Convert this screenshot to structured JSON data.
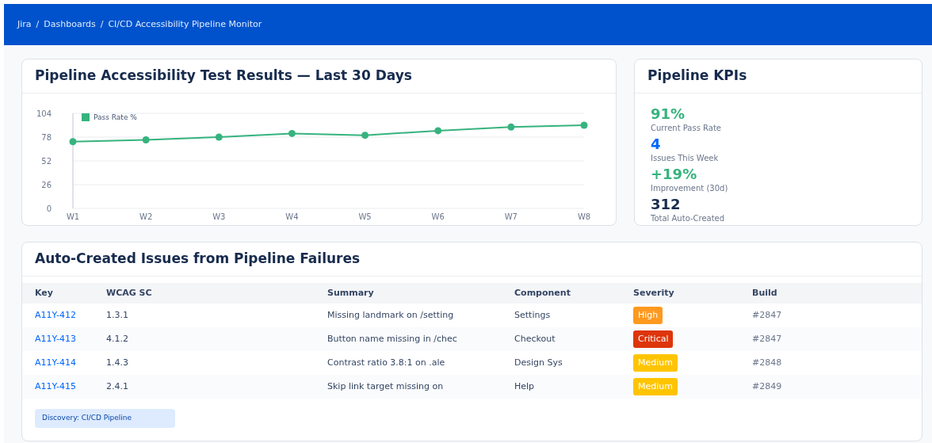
{
  "breadcrumb": [
    "Jira",
    "Dashboards",
    "CI/CD Accessibility Pipeline Monitor"
  ],
  "breadcrumb_separator": "/",
  "results_card": {
    "title": "Pipeline Accessibility Test Results — Last 30 Days",
    "chart_data": {
      "type": "line",
      "categories": [
        "W1",
        "W2",
        "W3",
        "W4",
        "W5",
        "W6",
        "W7",
        "W8"
      ],
      "series": [
        {
          "name": "Pass Rate %",
          "color": "#36b37e",
          "values": [
            73,
            75,
            78,
            82,
            80,
            85,
            89,
            91
          ]
        }
      ],
      "ylim": [
        0,
        104
      ],
      "yticks": [
        0,
        26,
        52,
        78,
        104
      ],
      "grid": true,
      "marker": true
    }
  },
  "kpi_card": {
    "title": "Pipeline KPIs",
    "kpis": [
      {
        "value": "91%",
        "label": "Current Pass Rate",
        "color": "#36b37e"
      },
      {
        "value": "4",
        "label": "Issues This Week",
        "color": "#0065ff"
      },
      {
        "value": "+19%",
        "label": "Improvement (30d)",
        "color": "#36b37e"
      },
      {
        "value": "312",
        "label": "Total Auto-Created",
        "color": "#172b4d"
      }
    ]
  },
  "issues_card": {
    "title": "Auto-Created Issues from Pipeline Failures",
    "columns": [
      "Key",
      "WCAG SC",
      "Summary",
      "Component",
      "Severity",
      "Build"
    ],
    "rows": [
      {
        "key": "A11Y-412",
        "wcag": "1.3.1",
        "summary": "Missing landmark on /setting",
        "component": "Settings",
        "severity": "High",
        "color": "#ff991f",
        "build": "#2847"
      },
      {
        "key": "A11Y-413",
        "wcag": "4.1.2",
        "summary": "Button name missing in /chec",
        "component": "Checkout",
        "severity": "Critical",
        "color": "#de350b",
        "build": "#2847"
      },
      {
        "key": "A11Y-414",
        "wcag": "1.4.3",
        "summary": "Contrast ratio 3.8:1 on .ale",
        "component": "Design Sys",
        "severity": "Medium",
        "color": "#ffc400",
        "build": "#2848"
      },
      {
        "key": "A11Y-415",
        "wcag": "2.4.1",
        "summary": "Skip link target missing on",
        "component": "Help",
        "severity": "Medium",
        "color": "#ffc400",
        "build": "#2849"
      }
    ],
    "tag": "Discovery: CI/CD Pipeline"
  }
}
